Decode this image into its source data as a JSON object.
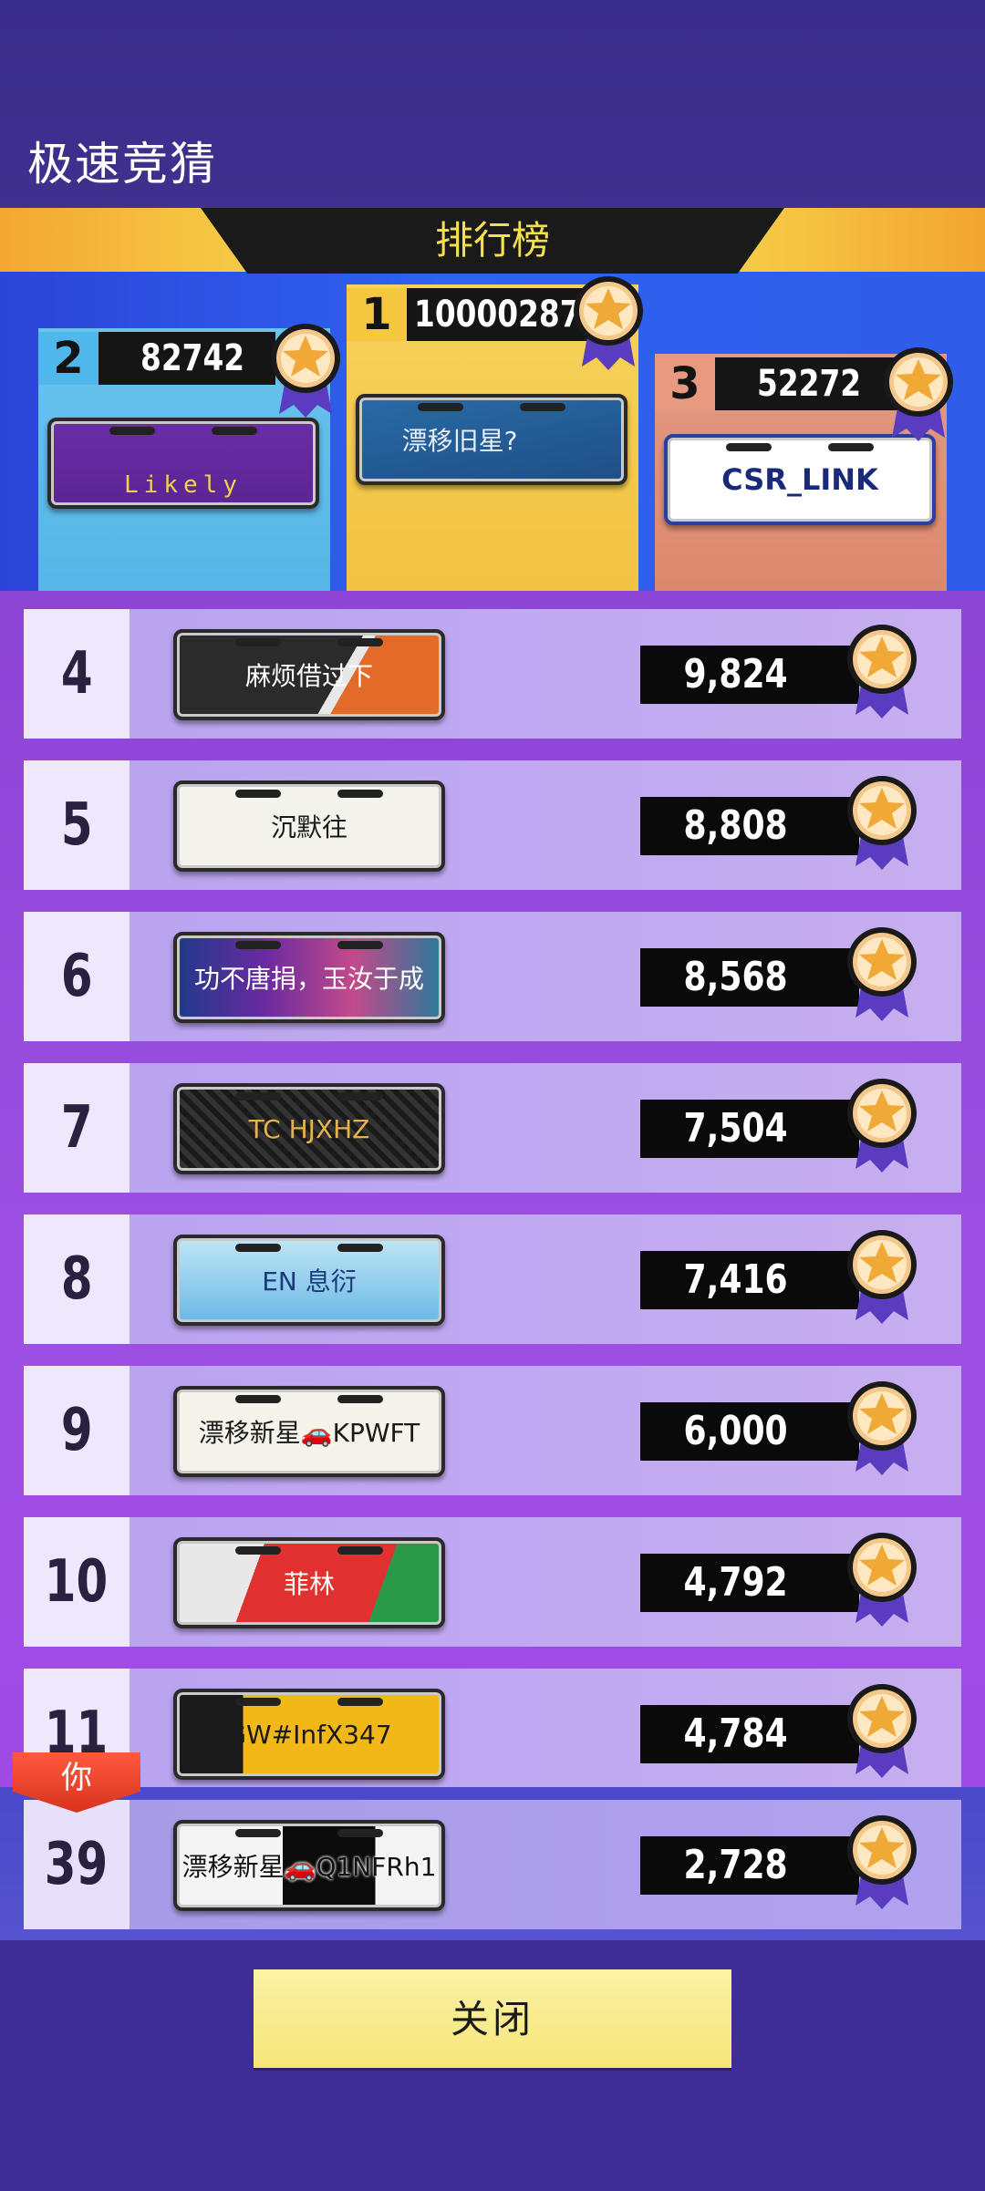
{
  "header": {
    "title": "极速竞猜"
  },
  "banner": {
    "title": "排行榜"
  },
  "podium": [
    {
      "rank": "1",
      "score": "100002879",
      "plate": "漂移旧星?"
    },
    {
      "rank": "2",
      "score": "82742",
      "plate": "Likely"
    },
    {
      "rank": "3",
      "score": "52272",
      "plate": "CSR_LINK"
    }
  ],
  "rows": [
    {
      "rank": "4",
      "plate": "麻烦借过下",
      "score": "9,824"
    },
    {
      "rank": "5",
      "plate": "沉默往",
      "score": "8,808"
    },
    {
      "rank": "6",
      "plate": "功不唐捐，玉汝于成",
      "score": "8,568"
    },
    {
      "rank": "7",
      "plate": "TC HJXHZ",
      "score": "7,504"
    },
    {
      "rank": "8",
      "plate": "EN 息衍",
      "score": "7,416"
    },
    {
      "rank": "9",
      "plate": "漂移新星🚗KPWFT",
      "score": "6,000"
    },
    {
      "rank": "10",
      "plate": "菲林",
      "score": "4,792"
    },
    {
      "rank": "11",
      "plate": "GW#InfX347",
      "score": "4,784"
    }
  ],
  "you": {
    "badge": "你",
    "rank": "39",
    "plate": "漂移新星🚗Q1NFRh1",
    "score": "2,728"
  },
  "footer": {
    "close_label": "关闭"
  },
  "colors": {
    "accent_yellow": "#f6e57a",
    "podium_blue": "#2f62f0",
    "list_purple": "#9c4fe2"
  },
  "icons": {
    "medal": "star-medal-icon"
  }
}
